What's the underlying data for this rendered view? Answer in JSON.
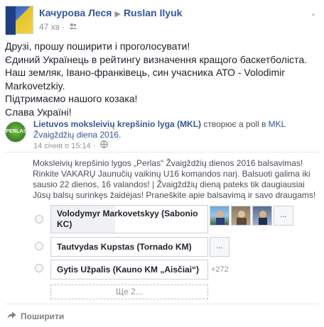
{
  "post": {
    "author": "Качурова Леся",
    "target": "Ruslan Ilyuk",
    "time": "47 хв",
    "lines": [
      "Друзі, прошу поширити і проголосувати!",
      "Єдиний Українець в рейтингу визначення кращого баскетболіста.",
      "Наш земляк, Івано-франківець, син учасника АТО - Volodimir",
      "Markovetzkiy.",
      "Підтримаємо нашого козака!",
      "Слава Україні!"
    ]
  },
  "shared": {
    "page_name": "Lietuvos moksleivių krepšinio lyga (MKL)",
    "action": " створює a poll в ",
    "target": "MKL Žvaigždžių diena 2016",
    "time": "14 січня о 15:14",
    "badge": "PERLAS",
    "poll_description": "Moksleivių krepšinio lygos „Perlas“ Žvaigždžių dienos 2016 balsavimas! Rinkite VAKARŲ Jaunučių vaikinų U16 komandos narį. Balsuoti galima iki sausio 22 dienos, 16 valandos! | Žvaigždžių dieną pateks tik daugiausiai Jūsų balsų surinkęs žaidėjas! Praneškite apie balsavimą ir savo draugams!"
  },
  "poll": {
    "options": [
      {
        "label": "Volodymyr Markovetskyy (Sabonio KC)",
        "more": "...",
        "fill": 0.41
      },
      {
        "label": "Tautvydas Kupstas (Tornado KM)",
        "more": "...",
        "fill": 0
      },
      {
        "label": "Gytis Užpalis (Kauno KM „Aisčiai“)",
        "count": "+272",
        "fill": 0
      }
    ],
    "see_more": "Ще 2..."
  },
  "actions": {
    "share": "Поширити"
  }
}
